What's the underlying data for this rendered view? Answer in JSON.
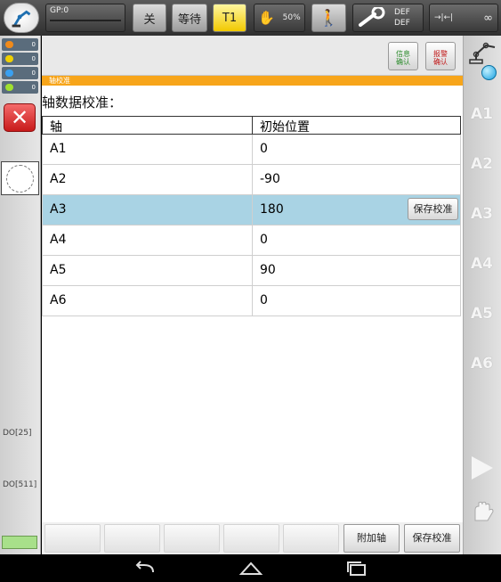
{
  "topbar": {
    "gp_label": "GP:0",
    "off_label": "关",
    "wait_label": "等待",
    "mode_label": "T1",
    "speed_label": "50%",
    "tool_def": "DEF",
    "base_def": "DEF",
    "base_infinity": "∞"
  },
  "leftcol": {
    "leds": [
      {
        "count": "0",
        "color": "#f08a1a"
      },
      {
        "count": "0",
        "color": "#f0d000"
      },
      {
        "count": "0",
        "color": "#3aa0f0"
      },
      {
        "count": "0",
        "color": "#a0e030"
      }
    ],
    "do25": "DO[25]",
    "do511": "DO[511]"
  },
  "messages": {
    "info_ack": "信息\n确认",
    "alarm_ack": "报警\n确认"
  },
  "window_tab": "轴校准",
  "section_title": "轴数据校准：",
  "table": {
    "headers": [
      "轴",
      "初始位置"
    ],
    "rows": [
      {
        "axis": "A1",
        "value": "0"
      },
      {
        "axis": "A2",
        "value": "-90"
      },
      {
        "axis": "A3",
        "value": "180"
      },
      {
        "axis": "A4",
        "value": "0"
      },
      {
        "axis": "A5",
        "value": "90"
      },
      {
        "axis": "A6",
        "value": "0"
      }
    ],
    "selected_row": 2,
    "row_save_label": "保存校准"
  },
  "bottombar": {
    "softkeys": [
      "",
      "",
      "",
      "",
      "",
      "附加轴",
      "保存校准"
    ]
  },
  "rightcol": {
    "axis_labels": [
      "A1",
      "A2",
      "A3",
      "A4",
      "A5",
      "A6"
    ]
  },
  "colors": {
    "accent_orange": "#f7a51a",
    "selected_row": "#a9d3e4",
    "mode_yellow": "#f1c900"
  }
}
